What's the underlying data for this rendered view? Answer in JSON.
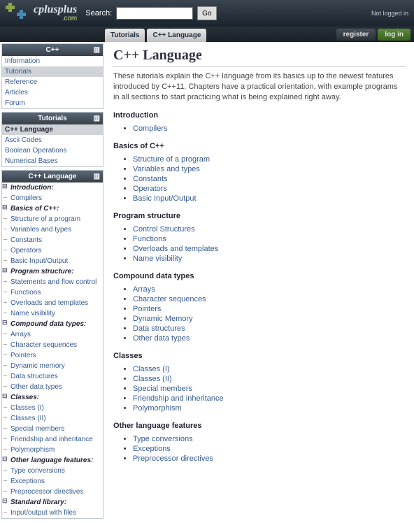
{
  "logo": {
    "text": "cplusplus",
    "sub": ".com"
  },
  "search": {
    "label": "Search:",
    "placeholder": "",
    "button": "Go"
  },
  "top_right": "Not logged in",
  "nav": {
    "crumbs": [
      "Tutorials",
      "C++ Language"
    ],
    "register": "register",
    "login": "log in"
  },
  "boxes": [
    {
      "title": "C++",
      "items": [
        {
          "label": "Information"
        },
        {
          "label": "Tutorials",
          "sel": true
        },
        {
          "label": "Reference"
        },
        {
          "label": "Articles"
        },
        {
          "label": "Forum"
        }
      ]
    },
    {
      "title": "Tutorials",
      "items": [
        {
          "label": "C++ Language",
          "sel": true,
          "bold": true
        },
        {
          "label": "Ascii Codes"
        },
        {
          "label": "Boolean Operations"
        },
        {
          "label": "Numerical Bases"
        }
      ]
    },
    {
      "title": "C++ Language",
      "tree": true,
      "items": [
        {
          "label": "Introduction:",
          "group": true
        },
        {
          "label": "Compilers"
        },
        {
          "label": "Basics of C++:",
          "group": true
        },
        {
          "label": "Structure of a program"
        },
        {
          "label": "Variables and types"
        },
        {
          "label": "Constants"
        },
        {
          "label": "Operators"
        },
        {
          "label": "Basic Input/Output"
        },
        {
          "label": "Program structure:",
          "group": true
        },
        {
          "label": "Statements and flow control"
        },
        {
          "label": "Functions"
        },
        {
          "label": "Overloads and templates"
        },
        {
          "label": "Name visibility"
        },
        {
          "label": "Compound data types:",
          "group": true
        },
        {
          "label": "Arrays"
        },
        {
          "label": "Character sequences"
        },
        {
          "label": "Pointers"
        },
        {
          "label": "Dynamic memory"
        },
        {
          "label": "Data structures"
        },
        {
          "label": "Other data types"
        },
        {
          "label": "Classes:",
          "group": true
        },
        {
          "label": "Classes (I)"
        },
        {
          "label": "Classes (II)"
        },
        {
          "label": "Special members"
        },
        {
          "label": "Friendship and inheritance"
        },
        {
          "label": "Polymorphism"
        },
        {
          "label": "Other language features:",
          "group": true
        },
        {
          "label": "Type conversions"
        },
        {
          "label": "Exceptions"
        },
        {
          "label": "Preprocessor directives"
        },
        {
          "label": "Standard library:",
          "group": true
        },
        {
          "label": "Input/output with files"
        }
      ]
    }
  ],
  "page": {
    "title": "C++ Language",
    "intro": "These tutorials explain the C++ language from its basics up to the newest features introduced by C++11. Chapters have a practical orientation, with example programs in all sections to start practicing what is being explained right away.",
    "sections": [
      {
        "title": "Introduction",
        "links": [
          "Compilers"
        ]
      },
      {
        "title": "Basics of C++",
        "links": [
          "Structure of a program",
          "Variables and types",
          "Constants",
          "Operators",
          "Basic Input/Output"
        ]
      },
      {
        "title": "Program structure",
        "links": [
          "Control Structures",
          "Functions",
          "Overloads and templates",
          "Name visibility"
        ]
      },
      {
        "title": "Compound data types",
        "links": [
          "Arrays",
          "Character sequences",
          "Pointers",
          "Dynamic Memory",
          "Data structures",
          "Other data types"
        ]
      },
      {
        "title": "Classes",
        "links": [
          "Classes (I)",
          "Classes (II)",
          "Special members",
          "Friendship and inheritance",
          "Polymorphism"
        ]
      },
      {
        "title": "Other language features",
        "links": [
          "Type conversions",
          "Exceptions",
          "Preprocessor directives"
        ]
      }
    ]
  }
}
